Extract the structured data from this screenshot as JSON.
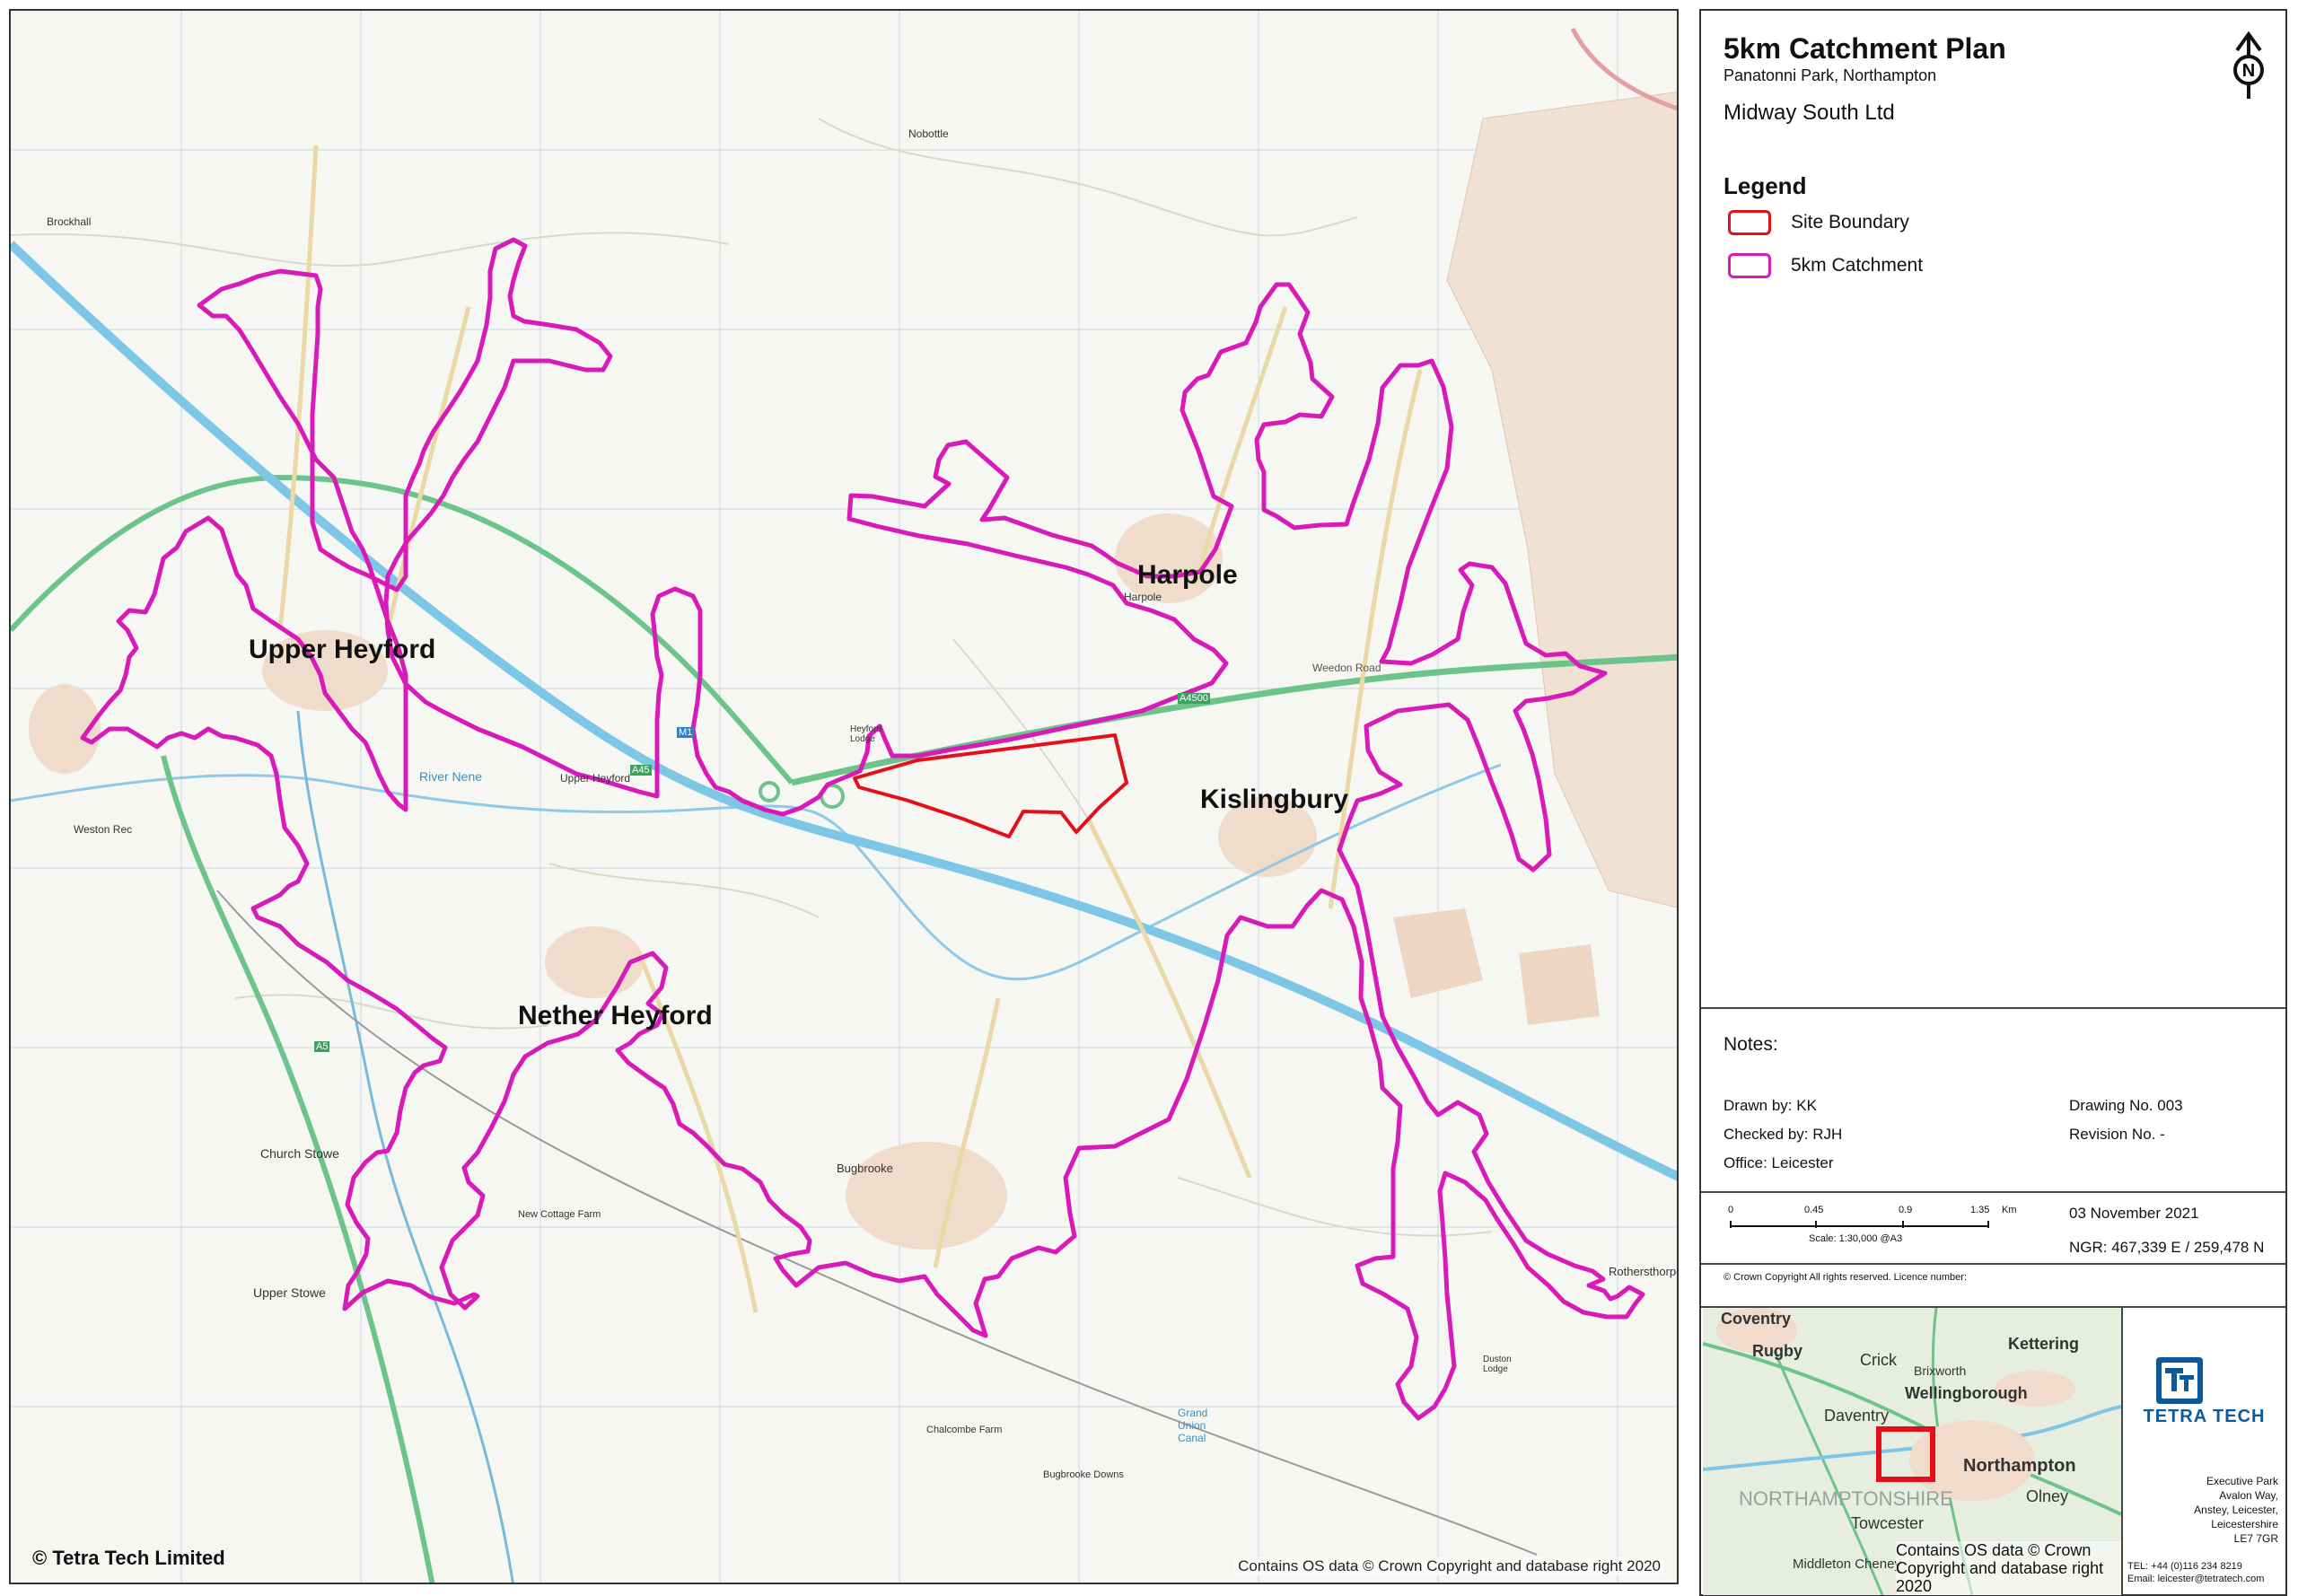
{
  "map": {
    "towns": [
      {
        "name": "Upper Heyford"
      },
      {
        "name": "Harpole"
      },
      {
        "name": "Kislingbury"
      },
      {
        "name": "Nether Heyford"
      }
    ],
    "minor_labels": [
      "Brockhall",
      "Upper Heyford",
      "River Nene",
      "Weston Rec",
      "Grand Union Canal",
      "Church Stowe",
      "Upper Stowe",
      "Bugbrooke",
      "Harpole",
      "Nobottle",
      "A4500",
      "M1",
      "A5",
      "A45",
      "Weedon Road",
      "Heyford Lodge",
      "New Cottage Farm",
      "Duston Lodge",
      "Rothersthorpe",
      "Chalcombe Farm",
      "Bugbrooke Downs"
    ],
    "copyright_left": "© Tetra Tech Limited",
    "copyright_right": "Contains OS data © Crown Copyright and database right 2020",
    "colors": {
      "site_boundary": "#e3101a",
      "catchment": "#d81bb8",
      "motorway": "#7ec6e6",
      "a_road": "#6cc48a"
    }
  },
  "panel": {
    "title": "5km Catchment Plan",
    "subtitle": "Panatonni Park, Northampton",
    "client": "Midway South Ltd",
    "north_icon": "north-arrow-icon",
    "legend": {
      "heading": "Legend",
      "items": [
        {
          "label": "Site Boundary",
          "color": "#e3101a"
        },
        {
          "label": "5km Catchment",
          "color": "#d81bb8"
        }
      ]
    },
    "notes_label": "Notes:",
    "drawn_by": "Drawn by: KK",
    "checked_by": "Checked by: RJH",
    "office": "Office: Leicester",
    "drawing_no": "Drawing No. 003",
    "revision_no": "Revision No. -",
    "scale": {
      "ticks": [
        "0",
        "0.45",
        "0.9",
        "1.35"
      ],
      "unit": "Km",
      "text": "Scale: 1:30,000 @A3"
    },
    "date": "03 November 2021",
    "ngr": "NGR: 467,339 E / 259,478 N",
    "crown_copyright": "© Crown Copyright All rights reserved. Licence number:",
    "inset": {
      "labels": [
        "Coventry",
        "Rugby",
        "Kettering",
        "Wellingborough",
        "Daventry",
        "Northampton",
        "NORTHAMPTONSHIRE",
        "Towcester",
        "Olney",
        "Crick",
        "Brixworth",
        "Middleton Cheney"
      ],
      "copyright": "Contains OS data © Crown Copyright and database right 2020"
    },
    "company": {
      "name": "TETRA TECH",
      "address": [
        "Executive Park",
        "Avalon Way,",
        "Anstey, Leicester,",
        "Leicestershire",
        "LE7 7GR"
      ],
      "tel": "TEL: +44 (0)116 234 8219",
      "email": "Email: leicester@tetratech.com"
    }
  }
}
